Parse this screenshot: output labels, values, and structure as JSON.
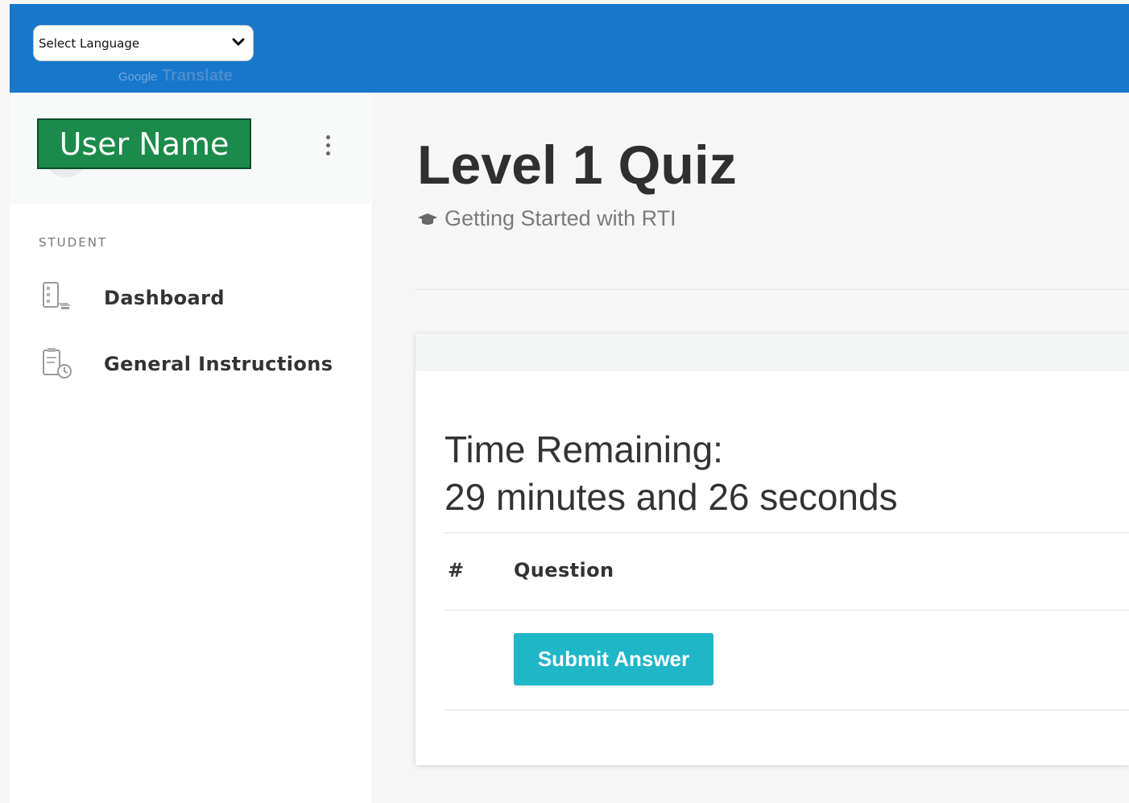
{
  "translate": {
    "select_label": "Select Language",
    "powered_brand": "Google",
    "powered_text": "Translate"
  },
  "sidebar": {
    "user_name": "User Name",
    "section_label": "STUDENT",
    "items": [
      {
        "label": "Dashboard",
        "icon": "dashboard-icon"
      },
      {
        "label": "General Instructions",
        "icon": "instructions-icon"
      }
    ]
  },
  "main": {
    "title": "Level 1 Quiz",
    "course": "Getting Started with RTI",
    "timer": {
      "heading": "Time Remaining:",
      "value": "29 minutes and 26 seconds"
    },
    "table": {
      "headers": [
        "#",
        "Question"
      ]
    },
    "submit_label": "Submit Answer"
  },
  "colors": {
    "topbar": "#1677cb",
    "user_badge": "#1b8a4b",
    "submit": "#1fb6c7"
  }
}
